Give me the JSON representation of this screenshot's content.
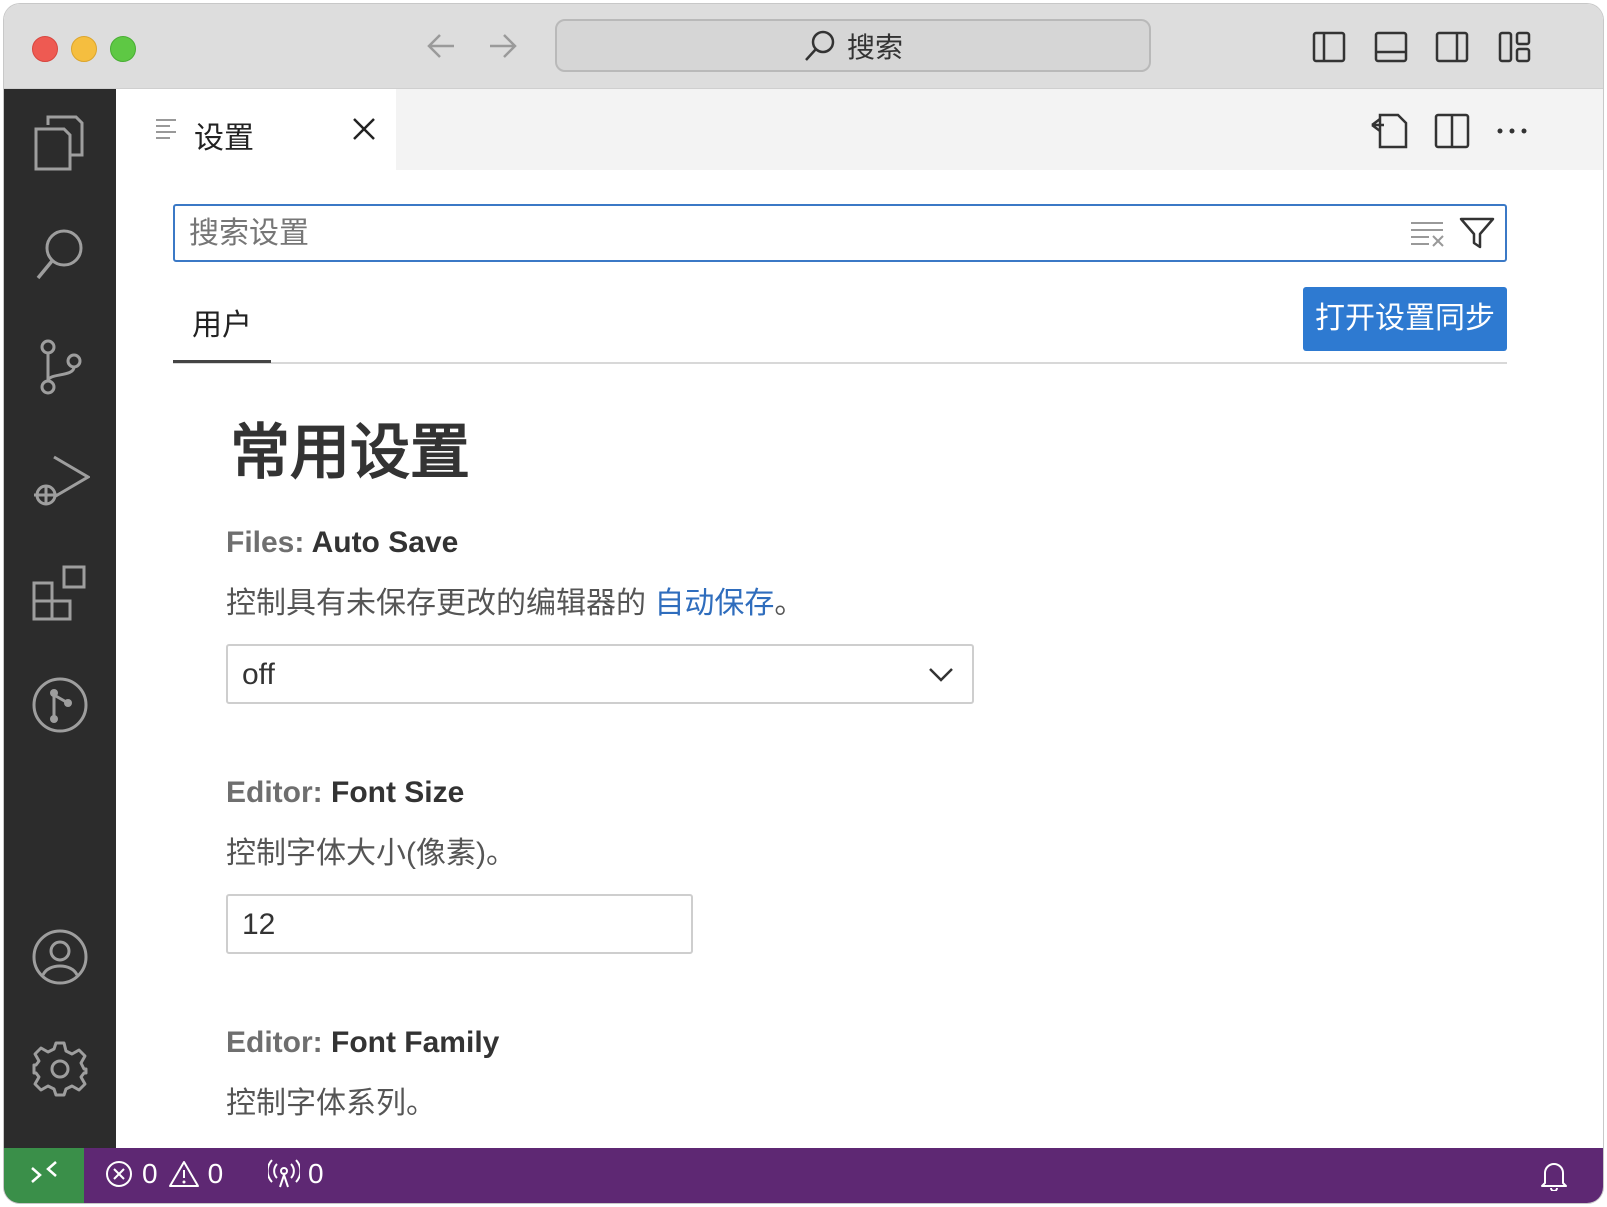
{
  "titlebar": {
    "search_label": "搜索"
  },
  "tab": {
    "label": "设置"
  },
  "settings": {
    "search_placeholder": "搜索设置",
    "scope_tab": "用户",
    "sync_button": "打开设置同步",
    "section_title": "常用设置",
    "items": [
      {
        "category": "Files: ",
        "name": "Auto Save",
        "description": "控制具有未保存更改的编辑器的 ",
        "description_link": "自动保存",
        "description_end": "。",
        "value": "off"
      },
      {
        "category": "Editor: ",
        "name": "Font Size",
        "description": "控制字体大小(像素)。",
        "value": "12"
      },
      {
        "category": "Editor: ",
        "name": "Font Family",
        "description": "控制字体系列。"
      }
    ]
  },
  "statusbar": {
    "errors": "0",
    "warnings": "0",
    "ports": "0"
  },
  "colors": {
    "accent": "#2e7ad1",
    "statusbar": "#5e2873",
    "remote": "#3a8f49",
    "activitybar": "#2c2c2c"
  }
}
